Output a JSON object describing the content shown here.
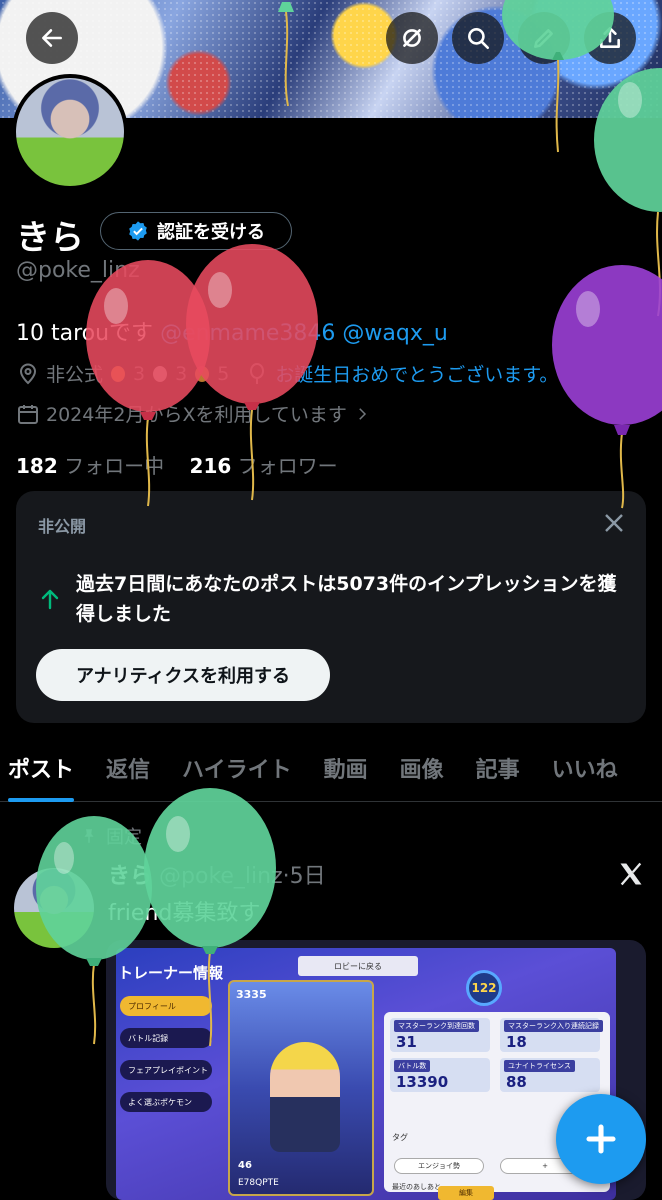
{
  "profile": {
    "name": "きら",
    "verify_label": "認証を受ける",
    "handle": "@poke_linz",
    "bio": {
      "text": "10 tarouです",
      "mention1": "@enmame3846",
      "mention2": "@waqx_u"
    },
    "location_prefix": "非公式",
    "medal_counts": [
      "3",
      "3",
      "5"
    ],
    "birthday_link": "お誕生日おめでとうございます。",
    "joined": "2024年2月からXを利用しています",
    "following_count": "182",
    "following_label": "フォロー中",
    "followers_count": "216",
    "followers_label": "フォロワー"
  },
  "private_card": {
    "title": "非公開",
    "message": "過去7日間にあなたのポストは5073件のインプレッションを獲得しました",
    "button_label": "アナリティクスを利用する"
  },
  "tabs": [
    {
      "label": "ポスト",
      "active": true
    },
    {
      "label": "返信"
    },
    {
      "label": "ハイライト"
    },
    {
      "label": "動画"
    },
    {
      "label": "画像"
    },
    {
      "label": "記事"
    },
    {
      "label": "いいね"
    }
  ],
  "post": {
    "pinned_label": "固定",
    "author": "きら",
    "handle": "@poke_linz",
    "time": "5日",
    "text": "friend募集致す",
    "image": {
      "title": "トレーナー情報",
      "lobby": "ロビーに戻る",
      "menu": [
        "プロフィール",
        "バトル記録",
        "フェアプレイポイント",
        "よく選ぶポケモン"
      ],
      "rating": "3335",
      "level": "122",
      "card_bottom": "46",
      "trainer_id": "E78QPTE",
      "stats": [
        {
          "label": "マスターランク到達回数",
          "value": "31"
        },
        {
          "label": "マスターランク入り連続記録",
          "value": "18"
        },
        {
          "label": "バトル数",
          "value": "13390"
        },
        {
          "label": "ユナイトライセンス",
          "value": "88"
        }
      ],
      "tags_label": "タグ",
      "tag1": "エンジョイ勢",
      "tag2": "+",
      "recent": "最近のあしあと",
      "edit": "編集"
    }
  },
  "icons": {
    "back": "back-arrow-icon",
    "location": "location-pin-icon",
    "calendar": "calendar-icon",
    "fab": "plus-icon"
  },
  "colors": {
    "accent": "#1d9bf0",
    "background": "#000000",
    "card": "#16181c",
    "balloon_red": "#e84a5f",
    "balloon_green": "#5fd39a",
    "balloon_purple": "#9b3fd6"
  }
}
